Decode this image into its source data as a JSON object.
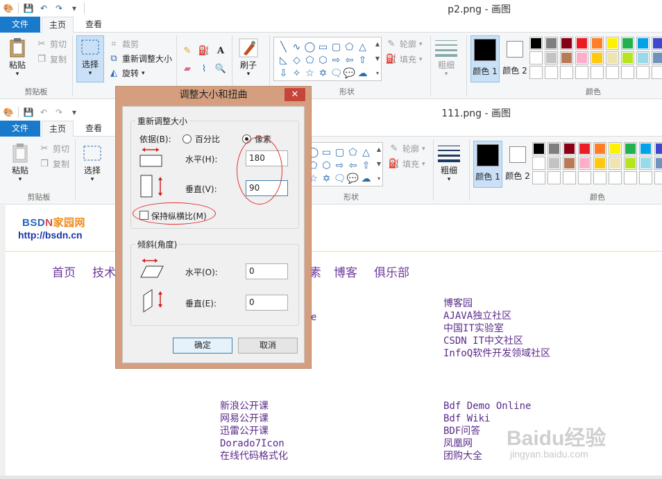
{
  "back_window": {
    "title": "p2.png - 画图",
    "tabs": [
      "文件",
      "主页",
      "查看"
    ],
    "clipboard": {
      "paste": "粘贴",
      "cut": "剪切",
      "copy": "复制",
      "group": "剪贴板"
    },
    "image": {
      "select": "选择",
      "crop": "裁剪",
      "resize": "重新调整大小",
      "rotate": "旋转"
    },
    "brush": "刷子",
    "outline": "轮廓",
    "fill": "填充",
    "shapes_group": "形状",
    "size": "粗细",
    "color1": "颜色 1",
    "color2": "颜色 2",
    "colors_group": "颜色"
  },
  "front_window": {
    "title": "111.png - 画图",
    "tabs": [
      "文件",
      "主页",
      "查看"
    ],
    "clipboard": {
      "paste": "粘贴",
      "cut": "剪切",
      "copy": "复制",
      "group": "剪贴板"
    },
    "select": "选择",
    "outline": "轮廓",
    "fill": "填充",
    "shapes_group": "形状",
    "size": "粗细",
    "color1": "颜色 1",
    "color2": "颜色 2",
    "colors_group": "颜色"
  },
  "palette": {
    "row1": [
      "#000000",
      "#7f7f7f",
      "#880015",
      "#ed1c24",
      "#ff7f27",
      "#fff200",
      "#22b14c",
      "#00a2e8",
      "#3f48cc",
      "#a349a4"
    ],
    "row2": [
      "#ffffff",
      "#c3c3c3",
      "#b97a57",
      "#ffaec9",
      "#ffc90e",
      "#efe4b0",
      "#b5e61d",
      "#99d9ea",
      "#7092be",
      "#c8bfe7"
    ]
  },
  "dialog": {
    "title": "调整大小和扭曲",
    "close": "✕",
    "resize_group": "重新调整大小",
    "by_label": "依据(B):",
    "percent": "百分比",
    "pixels": "像素",
    "horizontal_label": "水平(H):",
    "horizontal_value": "180",
    "vertical_label": "垂直(V):",
    "vertical_value": "90",
    "keep_ratio": "保持纵横比(M)",
    "skew_group": "倾斜(角度)",
    "skew_h_label": "水平(O):",
    "skew_h_value": "0",
    "skew_v_label": "垂直(E):",
    "skew_v_value": "0",
    "ok": "确定",
    "cancel": "取消"
  },
  "canvas": {
    "logo_b": "BSD",
    "logo_n": "N",
    "logo_cn": "家园网",
    "url": "http://bsdn.cn",
    "nav": [
      "首页",
      "技术",
      "素",
      "博客",
      "俱乐部"
    ],
    "frag": "ate",
    "col2_top": [
      "博客园",
      "AJAVA独立社区",
      "中国IT实验室",
      "CSDN IT中文社区",
      "InfoQ软件开发领域社区"
    ],
    "col1_bottom": [
      "新浪公开课",
      "网易公开课",
      "迅雷公开课",
      "Dorado7Icon",
      "在线代码格式化"
    ],
    "col2_bottom": [
      "Bdf Demo Online",
      "Bdf Wiki",
      "BDF问答",
      "凤凰网",
      "团购大全"
    ]
  },
  "watermark": {
    "main": "Baidu经验",
    "sub": "jingyan.baidu.com"
  }
}
